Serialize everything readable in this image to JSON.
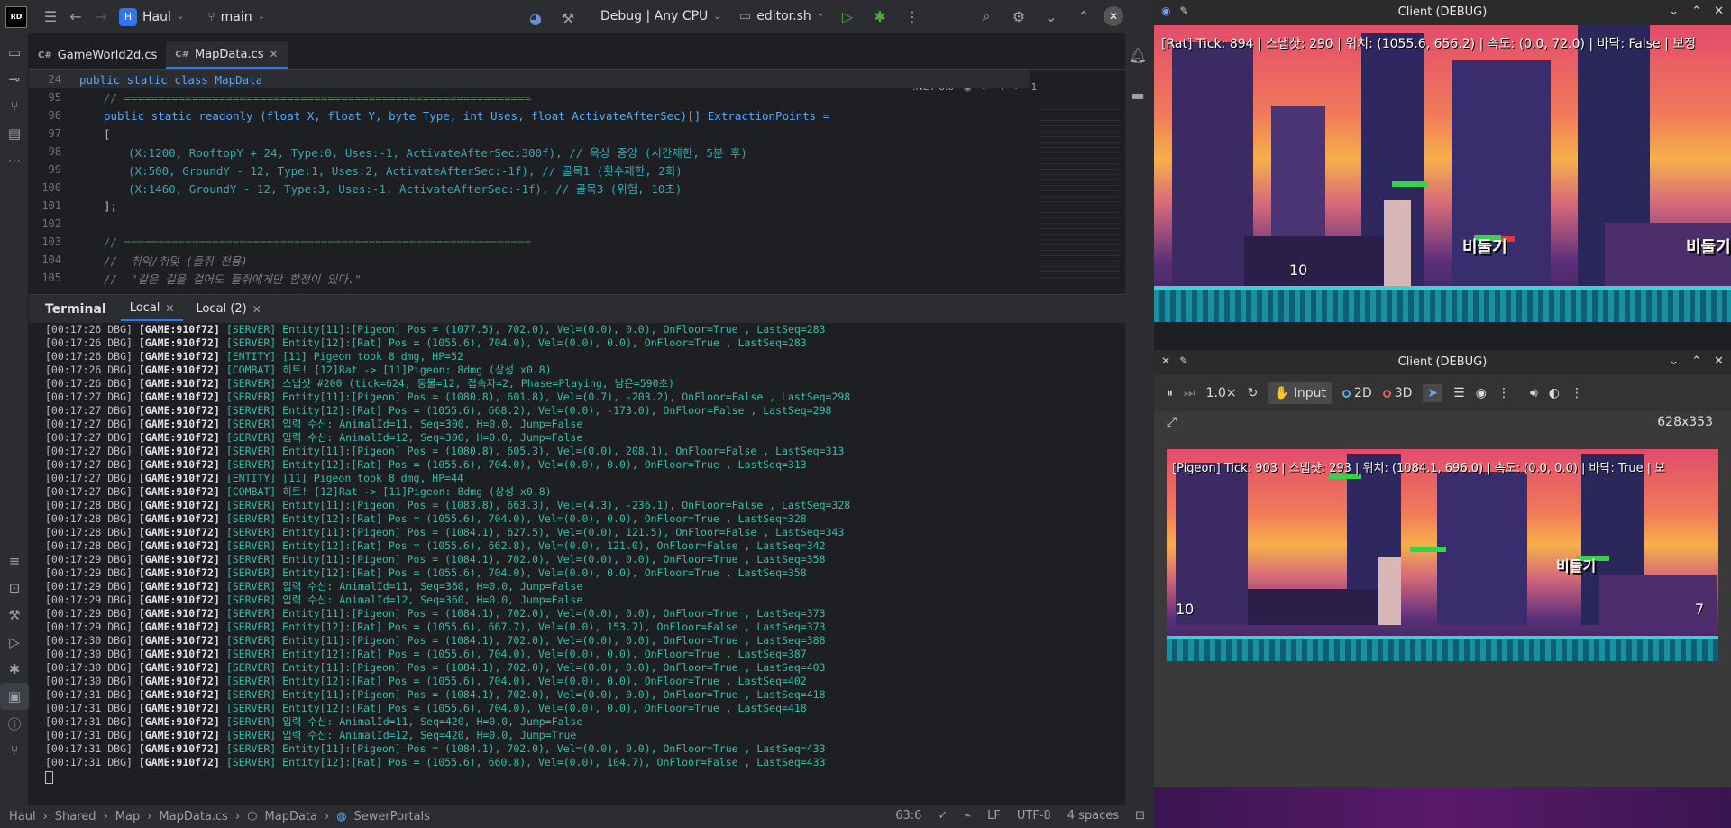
{
  "ide": {
    "project": {
      "badge": "H",
      "name": "Haul"
    },
    "branch": "main",
    "run_config": "Debug | Any CPU",
    "script": "editor.sh",
    "tabs": [
      {
        "lang": "C#",
        "label": "GameWorld2d.cs"
      },
      {
        "lang": "C#",
        "label": "MapData.cs"
      }
    ],
    "editor_badges": {
      "framework": ".NET 8.0",
      "checks": "4",
      "warnings": "1"
    },
    "editor_lines": [
      {
        "n": "24",
        "text": "public static class MapData"
      },
      {
        "n": "95",
        "text": "// ============================================================"
      },
      {
        "n": "96",
        "text": "public static readonly (float X, float Y, byte Type, int Uses, float ActivateAfterSec)[] ExtractionPoints ="
      },
      {
        "n": "97",
        "text": "["
      },
      {
        "n": "98",
        "text": "(X:1200, RooftopY + 24, Type:0, Uses:-1, ActivateAfterSec:300f), // 옥상 중앙 (시간제한, 5분 후)"
      },
      {
        "n": "99",
        "text": "(X:500, GroundY - 12, Type:1, Uses:2, ActivateAfterSec:-1f), // 골목1 (횟수제한, 2회)"
      },
      {
        "n": "100",
        "text": "(X:1460, GroundY - 12, Type:3, Uses:-1, ActivateAfterSec:-1f), // 골목3 (위험, 10초)"
      },
      {
        "n": "101",
        "text": "];"
      },
      {
        "n": "102",
        "text": ""
      },
      {
        "n": "103",
        "text": "// ============================================================"
      },
      {
        "n": "104",
        "text": "//  취약/취덫 (들쥐 전용)"
      },
      {
        "n": "105",
        "text": "//  \"같은 길을 걸어도 들쥐에게만 함정이 있다.\""
      }
    ],
    "terminal": {
      "title": "Terminal",
      "tabs": [
        "Local",
        "Local (2)"
      ],
      "lines": [
        {
          "p": "[00:17:26 DBG]",
          "g": "[GAME:910f72]",
          "t": "[SERVER] Entity[11]:[Pigeon] Pos = (1077.5), 702.0), Vel=(0.0), 0.0), OnFloor=True , LastSeq=283"
        },
        {
          "p": "[00:17:26 DBG]",
          "g": "[GAME:910f72]",
          "t": "[SERVER] Entity[12]:[Rat] Pos = (1055.6), 704.0), Vel=(0.0), 0.0), OnFloor=True , LastSeq=283"
        },
        {
          "p": "[00:17:26 DBG]",
          "g": "[GAME:910f72]",
          "t": "[ENTITY] [11] Pigeon took 8 dmg, HP=52"
        },
        {
          "p": "[00:17:26 DBG]",
          "g": "[GAME:910f72]",
          "t": "[COMBAT] 히트! [12]Rat -> [11]Pigeon: 8dmg (상성 x0.8)"
        },
        {
          "p": "[00:17:26 DBG]",
          "g": "[GAME:910f72]",
          "t": "[SERVER] 스냅샷 #200 (tick=624, 동물=12, 접속자=2, Phase=Playing, 남은=590초)"
        },
        {
          "p": "[00:17:27 DBG]",
          "g": "[GAME:910f72]",
          "t": "[SERVER] Entity[11]:[Pigeon] Pos = (1080.8), 601.8), Vel=(0.7), -203.2), OnFloor=False , LastSeq=298"
        },
        {
          "p": "[00:17:27 DBG]",
          "g": "[GAME:910f72]",
          "t": "[SERVER] Entity[12]:[Rat] Pos = (1055.6), 668.2), Vel=(0.0), -173.0), OnFloor=False , LastSeq=298"
        },
        {
          "p": "[00:17:27 DBG]",
          "g": "[GAME:910f72]",
          "t": "[SERVER] 입력 수신: AnimalId=11, Seq=300, H=0.0, Jump=False"
        },
        {
          "p": "[00:17:27 DBG]",
          "g": "[GAME:910f72]",
          "t": "[SERVER] 입력 수신: AnimalId=12, Seq=300, H=0.0, Jump=False"
        },
        {
          "p": "[00:17:27 DBG]",
          "g": "[GAME:910f72]",
          "t": "[SERVER] Entity[11]:[Pigeon] Pos = (1080.8), 605.3), Vel=(0.0), 208.1), OnFloor=False , LastSeq=313"
        },
        {
          "p": "[00:17:27 DBG]",
          "g": "[GAME:910f72]",
          "t": "[SERVER] Entity[12]:[Rat] Pos = (1055.6), 704.0), Vel=(0.0), 0.0), OnFloor=True , LastSeq=313"
        },
        {
          "p": "[00:17:27 DBG]",
          "g": "[GAME:910f72]",
          "t": "[ENTITY] [11] Pigeon took 8 dmg, HP=44"
        },
        {
          "p": "[00:17:27 DBG]",
          "g": "[GAME:910f72]",
          "t": "[COMBAT] 히트! [12]Rat -> [11]Pigeon: 8dmg (상성 x0.8)"
        },
        {
          "p": "[00:17:28 DBG]",
          "g": "[GAME:910f72]",
          "t": "[SERVER] Entity[11]:[Pigeon] Pos = (1083.8), 663.3), Vel=(4.3), -236.1), OnFloor=False , LastSeq=328"
        },
        {
          "p": "[00:17:28 DBG]",
          "g": "[GAME:910f72]",
          "t": "[SERVER] Entity[12]:[Rat] Pos = (1055.6), 704.0), Vel=(0.0), 0.0), OnFloor=True , LastSeq=328"
        },
        {
          "p": "[00:17:28 DBG]",
          "g": "[GAME:910f72]",
          "t": "[SERVER] Entity[11]:[Pigeon] Pos = (1084.1), 627.5), Vel=(0.0), 121.5), OnFloor=False , LastSeq=343"
        },
        {
          "p": "[00:17:28 DBG]",
          "g": "[GAME:910f72]",
          "t": "[SERVER] Entity[12]:[Rat] Pos = (1055.6), 662.8), Vel=(0.0), 121.0), OnFloor=False , LastSeq=342"
        },
        {
          "p": "[00:17:29 DBG]",
          "g": "[GAME:910f72]",
          "t": "[SERVER] Entity[11]:[Pigeon] Pos = (1084.1), 702.0), Vel=(0.0), 0.0), OnFloor=True , LastSeq=358"
        },
        {
          "p": "[00:17:29 DBG]",
          "g": "[GAME:910f72]",
          "t": "[SERVER] Entity[12]:[Rat] Pos = (1055.6), 704.0), Vel=(0.0), 0.0), OnFloor=True , LastSeq=358"
        },
        {
          "p": "[00:17:29 DBG]",
          "g": "[GAME:910f72]",
          "t": "[SERVER] 입력 수신: AnimalId=11, Seq=360, H=0.0, Jump=False"
        },
        {
          "p": "[00:17:29 DBG]",
          "g": "[GAME:910f72]",
          "t": "[SERVER] 입력 수신: AnimalId=12, Seq=360, H=0.0, Jump=False"
        },
        {
          "p": "[00:17:29 DBG]",
          "g": "[GAME:910f72]",
          "t": "[SERVER] Entity[11]:[Pigeon] Pos = (1084.1), 702.0), Vel=(0.0), 0.0), OnFloor=True , LastSeq=373"
        },
        {
          "p": "[00:17:29 DBG]",
          "g": "[GAME:910f72]",
          "t": "[SERVER] Entity[12]:[Rat] Pos = (1055.6), 667.7), Vel=(0.0), 153.7), OnFloor=False , LastSeq=373"
        },
        {
          "p": "[00:17:30 DBG]",
          "g": "[GAME:910f72]",
          "t": "[SERVER] Entity[11]:[Pigeon] Pos = (1084.1), 702.0), Vel=(0.0), 0.0), OnFloor=True , LastSeq=388"
        },
        {
          "p": "[00:17:30 DBG]",
          "g": "[GAME:910f72]",
          "t": "[SERVER] Entity[12]:[Rat] Pos = (1055.6), 704.0), Vel=(0.0), 0.0), OnFloor=True , LastSeq=387"
        },
        {
          "p": "[00:17:30 DBG]",
          "g": "[GAME:910f72]",
          "t": "[SERVER] Entity[11]:[Pigeon] Pos = (1084.1), 702.0), Vel=(0.0), 0.0), OnFloor=True , LastSeq=403"
        },
        {
          "p": "[00:17:30 DBG]",
          "g": "[GAME:910f72]",
          "t": "[SERVER] Entity[12]:[Rat] Pos = (1055.6), 704.0), Vel=(0.0), 0.0), OnFloor=True , LastSeq=402"
        },
        {
          "p": "[00:17:31 DBG]",
          "g": "[GAME:910f72]",
          "t": "[SERVER] Entity[11]:[Pigeon] Pos = (1084.1), 702.0), Vel=(0.0), 0.0), OnFloor=True , LastSeq=418"
        },
        {
          "p": "[00:17:31 DBG]",
          "g": "[GAME:910f72]",
          "t": "[SERVER] Entity[12]:[Rat] Pos = (1055.6), 704.0), Vel=(0.0), 0.0), OnFloor=True , LastSeq=418"
        },
        {
          "p": "[00:17:31 DBG]",
          "g": "[GAME:910f72]",
          "t": "[SERVER] 입력 수신: AnimalId=11, Seq=420, H=0.0, Jump=False"
        },
        {
          "p": "[00:17:31 DBG]",
          "g": "[GAME:910f72]",
          "t": "[SERVER] 입력 수신: AnimalId=12, Seq=420, H=0.0, Jump=True"
        },
        {
          "p": "[00:17:31 DBG]",
          "g": "[GAME:910f72]",
          "t": "[SERVER] Entity[11]:[Pigeon] Pos = (1084.1), 702.0), Vel=(0.0), 0.0), OnFloor=True , LastSeq=433"
        },
        {
          "p": "[00:17:31 DBG]",
          "g": "[GAME:910f72]",
          "t": "[SERVER] Entity[12]:[Rat] Pos = (1055.6), 660.8), Vel=(0.0), 104.7), OnFloor=False , LastSeq=433"
        }
      ]
    },
    "status": {
      "breadcrumbs": [
        "Haul",
        "Shared",
        "Map",
        "MapData.cs",
        "MapData",
        "SewerPortals"
      ],
      "position": "63:6",
      "line_sep": "LF",
      "encoding": "UTF-8",
      "indent": "4 spaces"
    }
  },
  "client_top": {
    "title": "Client (DEBUG)",
    "hud": "[Rat] Tick: 894 | 스냅샷: 290 | 위치: (1055.6, 656.2) | 속도: (0.0, 72.0) | 바닥: False | 보정",
    "nick1": "비둘기",
    "nick2": "비둘기",
    "score": "10"
  },
  "client_bottom": {
    "title": "Client (DEBUG)",
    "toolbar": {
      "speed": "1.0×",
      "input": "Input",
      "mode2d": "2D",
      "mode3d": "3D",
      "resolution": "628x353"
    },
    "hud": "[Pigeon] Tick: 903 | 스냅샷: 293 | 위치: (1084.1, 696.0) | 속도: (0.0, 0.0) | 바닥: True | 보",
    "nick": "비둘기",
    "score_left": "10",
    "score_right": "7"
  },
  "colors": {
    "accent": "#3574f0",
    "terminal_text": "#2fbfad",
    "hp_bar": "#35d24a"
  }
}
